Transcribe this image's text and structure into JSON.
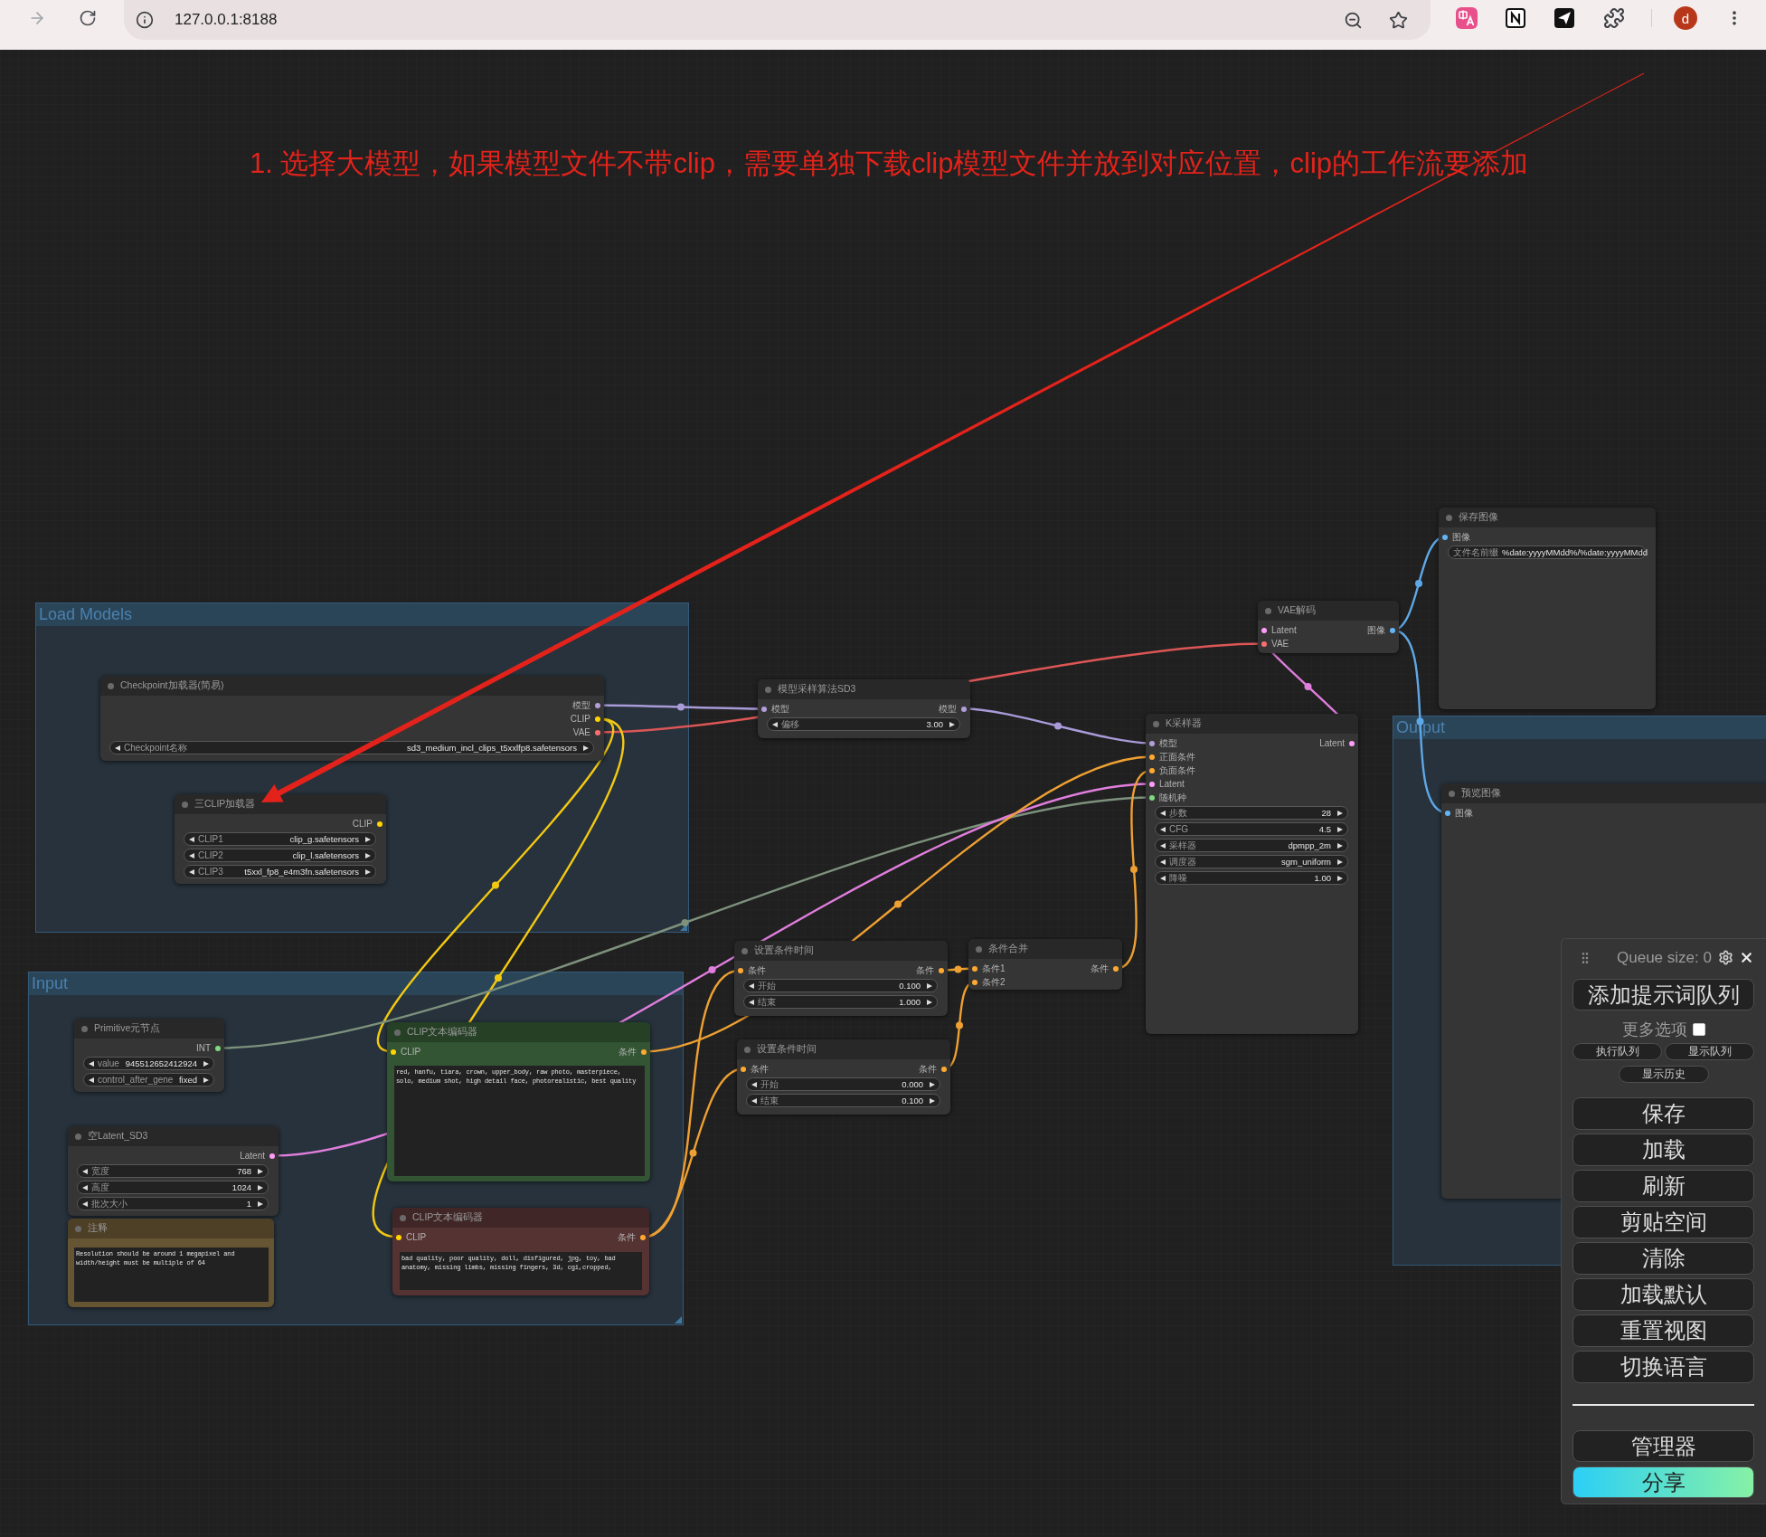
{
  "browser": {
    "url": "127.0.0.1:8188",
    "profile_initial": "d"
  },
  "annotation": {
    "text": "1. 选择大模型，如果模型文件不带clip，需要单独下载clip模型文件并放到对应位置，clip的工作流要添加"
  },
  "groups": [
    {
      "title": "Load Models"
    },
    {
      "title": "Input"
    },
    {
      "title": "Output"
    }
  ],
  "nodes": [
    {
      "title": "保存图像",
      "color": "#353535",
      "inputs": [
        {
          "label": "图像",
          "color": "#64b5f6"
        }
      ],
      "widgets": [
        {
          "kind": "text",
          "label": "文件名前缀",
          "value": "%date:yyyyMMdd%/%date:yyyyMMdd"
        }
      ]
    },
    {
      "title": "VAE解码",
      "color": "#353535",
      "inputs": [
        {
          "label": "Latent",
          "color": "#ff9cf9"
        },
        {
          "label": "VAE",
          "color": "#ff6e6e"
        }
      ],
      "outputs": [
        {
          "label": "图像",
          "color": "#64b5f6"
        }
      ]
    },
    {
      "title": "Checkpoint加载器(简易)",
      "color": "#353535",
      "outputs": [
        {
          "label": "模型",
          "color": "#b39ddb"
        },
        {
          "label": "CLIP",
          "color": "#ffd500"
        },
        {
          "label": "VAE",
          "color": "#ff6e6e"
        }
      ],
      "widgets": [
        {
          "kind": "stepper",
          "label": "Checkpoint名称",
          "value": "sd3_medium_incl_clips_t5xxlfp8.safetensors"
        }
      ]
    },
    {
      "title": "模型采样算法SD3",
      "color": "#353535",
      "inputs": [
        {
          "label": "模型",
          "color": "#b39ddb"
        }
      ],
      "outputs": [
        {
          "label": "模型",
          "color": "#b39ddb"
        }
      ],
      "widgets": [
        {
          "kind": "stepper",
          "label": "偏移",
          "value": "3.00"
        }
      ]
    },
    {
      "title": "K采样器",
      "color": "#353535",
      "inputs": [
        {
          "label": "模型",
          "color": "#b39ddb"
        },
        {
          "label": "正面条件",
          "color": "#ffa931"
        },
        {
          "label": "负面条件",
          "color": "#ffa931"
        },
        {
          "label": "Latent",
          "color": "#ff9cf9"
        },
        {
          "label": "随机种",
          "color": "#7fd97f"
        }
      ],
      "outputs": [
        {
          "label": "Latent",
          "color": "#ff9cf9"
        }
      ],
      "widgets": [
        {
          "kind": "stepper",
          "label": "步数",
          "value": "28"
        },
        {
          "kind": "stepper",
          "label": "CFG",
          "value": "4.5"
        },
        {
          "kind": "stepper",
          "label": "采样器",
          "value": "dpmpp_2m"
        },
        {
          "kind": "stepper",
          "label": "调度器",
          "value": "sgm_uniform"
        },
        {
          "kind": "stepper",
          "label": "降噪",
          "value": "1.00"
        }
      ]
    },
    {
      "title": "预览图像",
      "color": "#353535",
      "inputs": [
        {
          "label": "图像",
          "color": "#64b5f6"
        }
      ]
    },
    {
      "title": "三CLIP加载器",
      "color": "#353535",
      "outputs": [
        {
          "label": "CLIP",
          "color": "#ffd500"
        }
      ],
      "widgets": [
        {
          "kind": "stepper",
          "label": "CLIP1",
          "value": "clip_g.safetensors"
        },
        {
          "kind": "stepper",
          "label": "CLIP2",
          "value": "clip_l.safetensors"
        },
        {
          "kind": "stepper",
          "label": "CLIP3",
          "value": "t5xxl_fp8_e4m3fn.safetensors"
        }
      ]
    },
    {
      "title": "设置条件时间",
      "color": "#353535",
      "inputs": [
        {
          "label": "条件",
          "color": "#ffa931"
        }
      ],
      "outputs": [
        {
          "label": "条件",
          "color": "#ffa931"
        }
      ],
      "widgets": [
        {
          "kind": "stepper",
          "label": "开始",
          "value": "0.100"
        },
        {
          "kind": "stepper",
          "label": "结束",
          "value": "1.000"
        }
      ]
    },
    {
      "title": "条件合并",
      "color": "#353535",
      "inputs": [
        {
          "label": "条件1",
          "color": "#ffa931"
        },
        {
          "label": "条件2",
          "color": "#ffa931"
        }
      ],
      "outputs": [
        {
          "label": "条件",
          "color": "#ffa931"
        }
      ]
    },
    {
      "title": "Primitive元节点",
      "color": "#353535",
      "outputs": [
        {
          "label": "INT",
          "color": "#7fd97f"
        }
      ],
      "widgets": [
        {
          "kind": "stepper",
          "label": "value",
          "value": "945512652412924"
        },
        {
          "kind": "stepper",
          "label": "control_after_gene",
          "value": "fixed"
        }
      ]
    },
    {
      "title": "CLIP文本编码器",
      "color": "#335533",
      "inputs": [
        {
          "label": "CLIP",
          "color": "#ffd500"
        }
      ],
      "outputs": [
        {
          "label": "条件",
          "color": "#ffa931"
        }
      ],
      "prompt": "red, hanfu, tiara, crown, upper_body, raw photo, masterpiece, solo, medium shot, high detail face, photorealistic, best quality"
    },
    {
      "title": "设置条件时间",
      "color": "#353535",
      "inputs": [
        {
          "label": "条件",
          "color": "#ffa931"
        }
      ],
      "outputs": [
        {
          "label": "条件",
          "color": "#ffa931"
        }
      ],
      "widgets": [
        {
          "kind": "stepper",
          "label": "开始",
          "value": "0.000"
        },
        {
          "kind": "stepper",
          "label": "结束",
          "value": "0.100"
        }
      ]
    },
    {
      "title": "空Latent_SD3",
      "color": "#353535",
      "outputs": [
        {
          "label": "Latent",
          "color": "#ff9cf9"
        }
      ],
      "widgets": [
        {
          "kind": "stepper",
          "label": "宽度",
          "value": "768"
        },
        {
          "kind": "stepper",
          "label": "高度",
          "value": "1024"
        },
        {
          "kind": "stepper",
          "label": "批次大小",
          "value": "1"
        }
      ]
    },
    {
      "title": "CLIP文本编码器",
      "color": "#553333",
      "inputs": [
        {
          "label": "CLIP",
          "color": "#ffd500"
        }
      ],
      "outputs": [
        {
          "label": "条件",
          "color": "#ffa931"
        }
      ],
      "prompt": "bad quality, poor quality, doll, disfigured, jpg, toy, bad anatomy, missing limbs, missing fingers, 3d, cgi,cropped,"
    },
    {
      "title": "注释",
      "color": "#665533",
      "prompt": "Resolution should be around 1 megapixel and width/height must be multiple of 64"
    }
  ],
  "queue_panel": {
    "title": "Queue size: 0",
    "queue_button": "添加提示词队列",
    "more_options": {
      "label": "更多选项",
      "checked": false
    },
    "queue_actions": [
      "执行队列",
      "显示队列"
    ],
    "history_button": "显示历史",
    "menu_buttons": [
      "保存",
      "加载",
      "刷新",
      "剪贴空间",
      "清除",
      "加载默认",
      "重置视图",
      "切换语言"
    ],
    "extra_buttons": [
      {
        "label": "管理器",
        "kind": "plain"
      },
      {
        "label": "分享",
        "kind": "gradient"
      }
    ]
  }
}
